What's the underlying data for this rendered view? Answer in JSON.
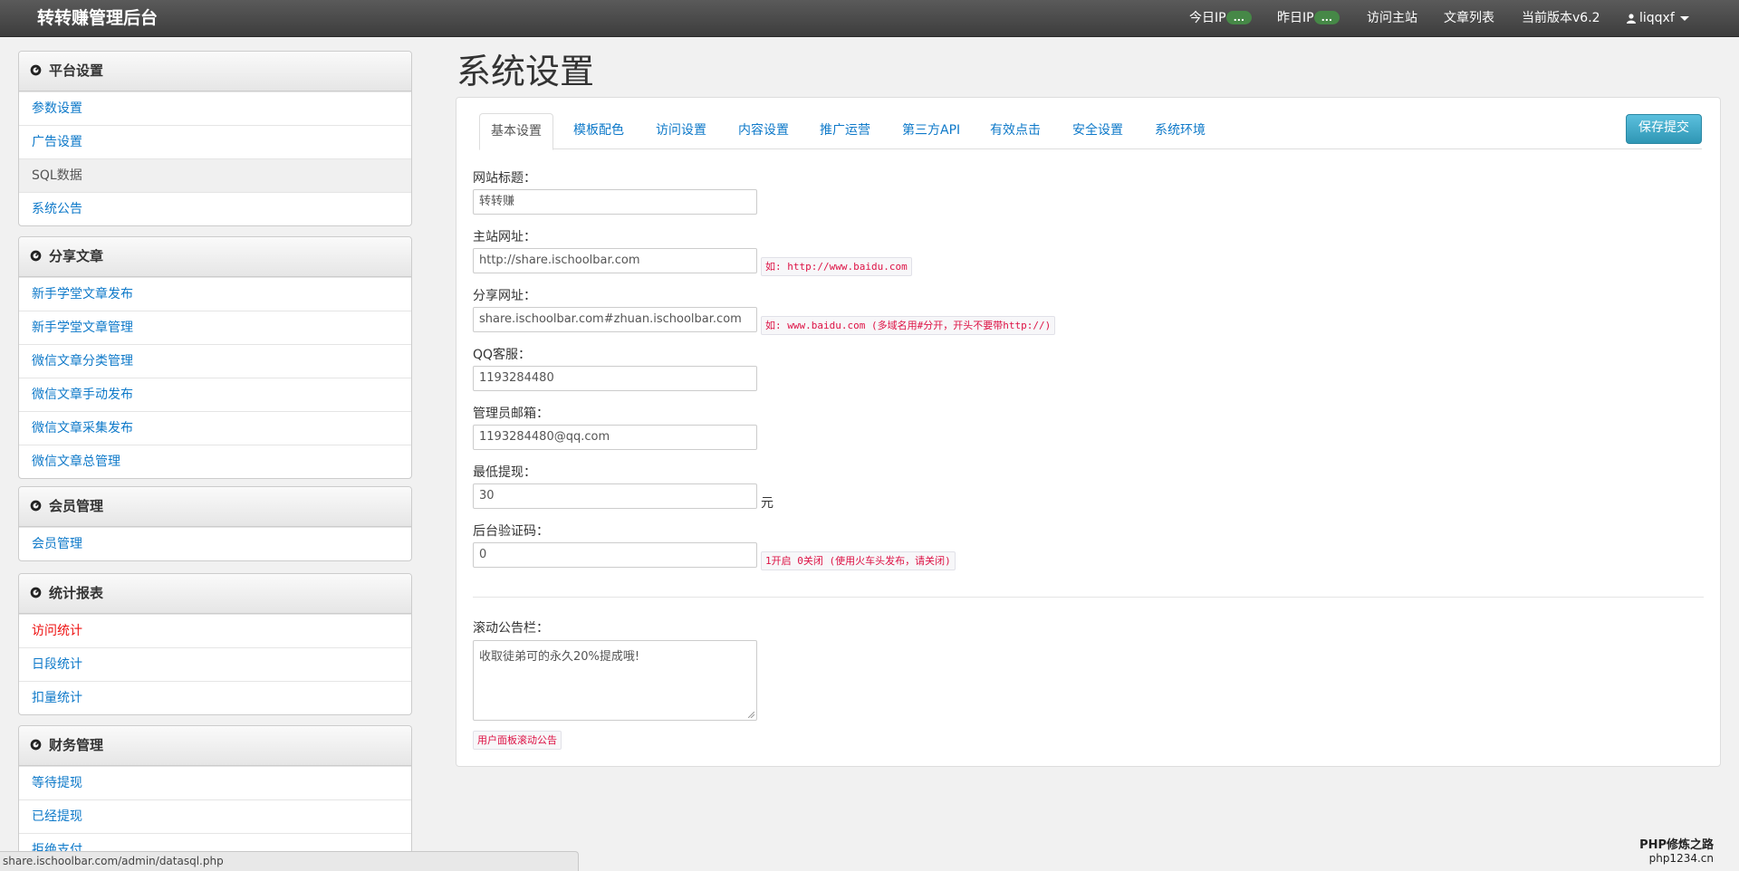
{
  "navbar": {
    "brand": "转转赚管理后台",
    "today_ip_label": "今日IP",
    "today_ip_badge": "...",
    "yesterday_ip_label": "昨日IP",
    "yesterday_ip_badge": "...",
    "visit_main": "访问主站",
    "article_list": "文章列表",
    "version": "当前版本v6.2",
    "user": "liqqxf",
    "icons": [
      "user-icon",
      "caret-down-icon"
    ]
  },
  "sidebar": {
    "panels": [
      {
        "title": "平台设置",
        "items": [
          "参数设置",
          "广告设置",
          "SQL数据",
          "系统公告"
        ]
      },
      {
        "title": "分享文章",
        "items": [
          "新手学堂文章发布",
          "新手学堂文章管理",
          "微信文章分类管理",
          "微信文章手动发布",
          "微信文章采集发布",
          "微信文章总管理"
        ]
      },
      {
        "title": "会员管理",
        "items": [
          "会员管理"
        ]
      },
      {
        "title": "统计报表",
        "items": [
          "访问统计",
          "日段统计",
          "扣量统计"
        ]
      },
      {
        "title": "财务管理",
        "items": [
          "等待提现",
          "已经提现",
          "拒绝支付"
        ]
      }
    ],
    "active_item": "SQL数据",
    "highlight_item": "访问统计",
    "icon": "dashboard-icon"
  },
  "main": {
    "title": "系统设置",
    "tabs": [
      "基本设置",
      "模板配色",
      "访问设置",
      "内容设置",
      "推广运营",
      "第三方API",
      "有效点击",
      "安全设置",
      "系统环境"
    ],
    "active_tab": "基本设置",
    "save_button": "保存提交",
    "fields": {
      "site_title": {
        "label": "网站标题：",
        "value": "转转赚"
      },
      "main_url": {
        "label": "主站网址：",
        "value": "http://share.ischoolbar.com",
        "hint": "如: http://www.baidu.com"
      },
      "share_url": {
        "label": "分享网址：",
        "value": "share.ischoolbar.com#zhuan.ischoolbar.com",
        "hint": "如: www.baidu.com (多域名用#分开，开头不要带http://)"
      },
      "qq_service": {
        "label": "QQ客服：",
        "value": "1193284480"
      },
      "admin_email": {
        "label": "管理员邮箱：",
        "value": "1193284480@qq.com"
      },
      "min_withdraw": {
        "label": "最低提现：",
        "value": "30",
        "unit": "元"
      },
      "admin_captcha": {
        "label": "后台验证码：",
        "value": "0",
        "hint": "1开启 0关闭 (使用火车头发布，请关闭)"
      },
      "marquee": {
        "label": "滚动公告栏：",
        "value": "收取徒弟可的永久20%提成哦!",
        "hint": "用户面板滚动公告"
      }
    }
  },
  "statusbar": {
    "url": "share.ischoolbar.com/admin/datasql.php"
  },
  "watermark": {
    "line1": "PHP修炼之路",
    "line2": "php1234.cn"
  },
  "colors": {
    "link": "#0e79c9",
    "badge": "#468847",
    "save_button": "#2f96b4",
    "hint_text": "#d14",
    "red_link": "#e11"
  }
}
